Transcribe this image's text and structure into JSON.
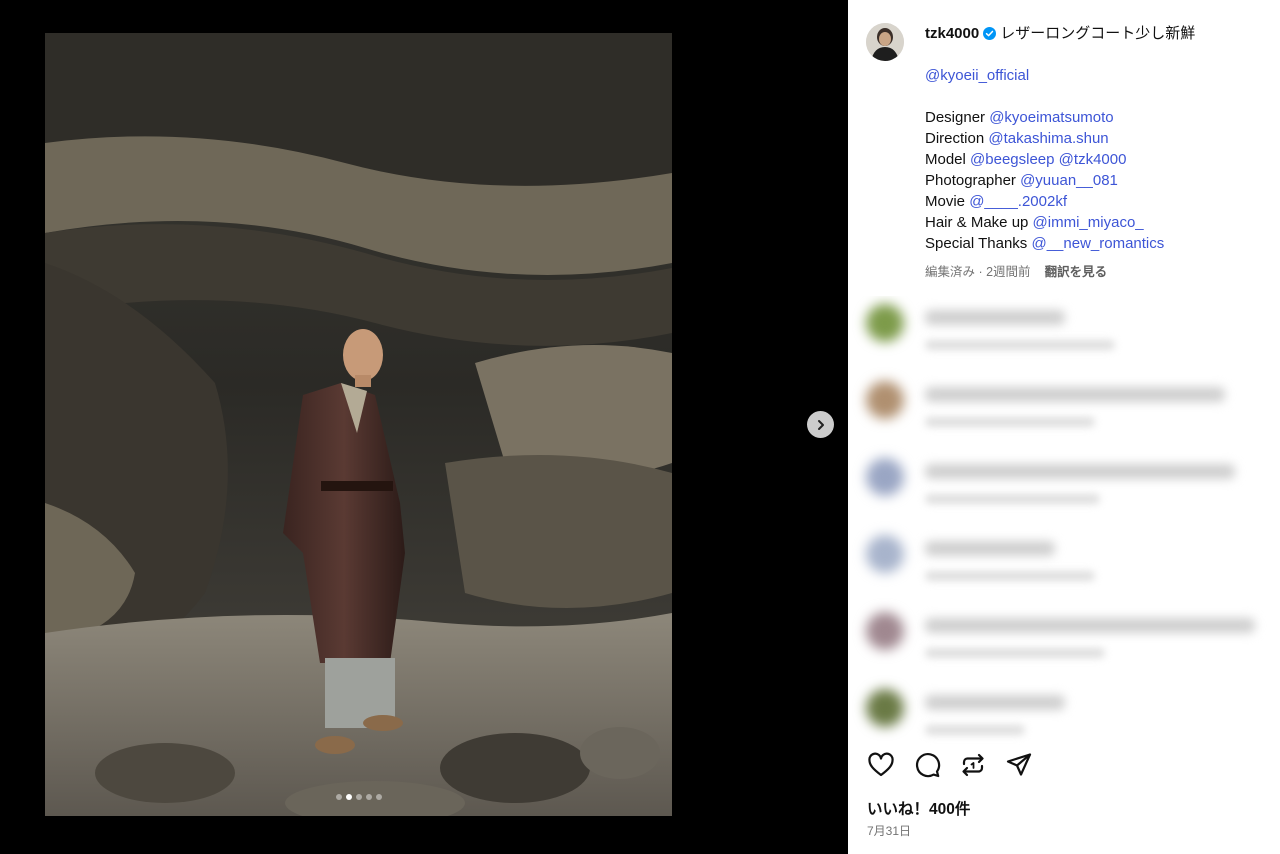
{
  "post": {
    "carousel": {
      "total": 5,
      "active": 1
    }
  },
  "caption": {
    "username": "tzk4000",
    "text": "レザーロングコート少し新鮮",
    "mention_brand": "@kyoeii_official",
    "credits": [
      {
        "role": "Designer",
        "handles": [
          "@kyoeimatsumoto"
        ]
      },
      {
        "role": "Direction",
        "handles": [
          "@takashima.shun"
        ]
      },
      {
        "role": "Model",
        "handles": [
          "@beegsleep",
          "@tzk4000"
        ]
      },
      {
        "role": "Photographer",
        "handles": [
          "@yuuan__081"
        ]
      },
      {
        "role": "Movie",
        "handles": [
          "@____.2002kf"
        ]
      },
      {
        "role": "Hair & Make up",
        "handles": [
          "@immi_miyaco_"
        ]
      },
      {
        "role": "Special Thanks",
        "handles": [
          "@__new_romantics"
        ]
      }
    ],
    "meta_edited": "編集済み · 2週間前",
    "translate": "翻訳を見る"
  },
  "comments": [
    {
      "avatar_color": "#7d9b4a",
      "w1": 140,
      "w2": 190,
      "text": ""
    },
    {
      "avatar_color": "#b09070",
      "w1": 300,
      "w2": 170,
      "text": ""
    },
    {
      "avatar_color": "#9aa6c4",
      "w1": 310,
      "w2": 175,
      "text": ""
    },
    {
      "avatar_color": "#a8b4cc",
      "w1": 130,
      "w2": 170,
      "text": ""
    },
    {
      "avatar_color": "#a08890",
      "w1": 330,
      "w2": 180,
      "text": ""
    },
    {
      "avatar_color": "#6a7a45",
      "w1": 140,
      "w2": 100,
      "text": ""
    }
  ],
  "actions": {
    "likes": "いいね！400件",
    "date": "7月31日",
    "icons": [
      "heart-icon",
      "comment-icon",
      "repost-icon",
      "share-icon"
    ]
  },
  "colors": {
    "link": "#3d55d6",
    "verified": "#0095f6",
    "meta": "#737373"
  }
}
